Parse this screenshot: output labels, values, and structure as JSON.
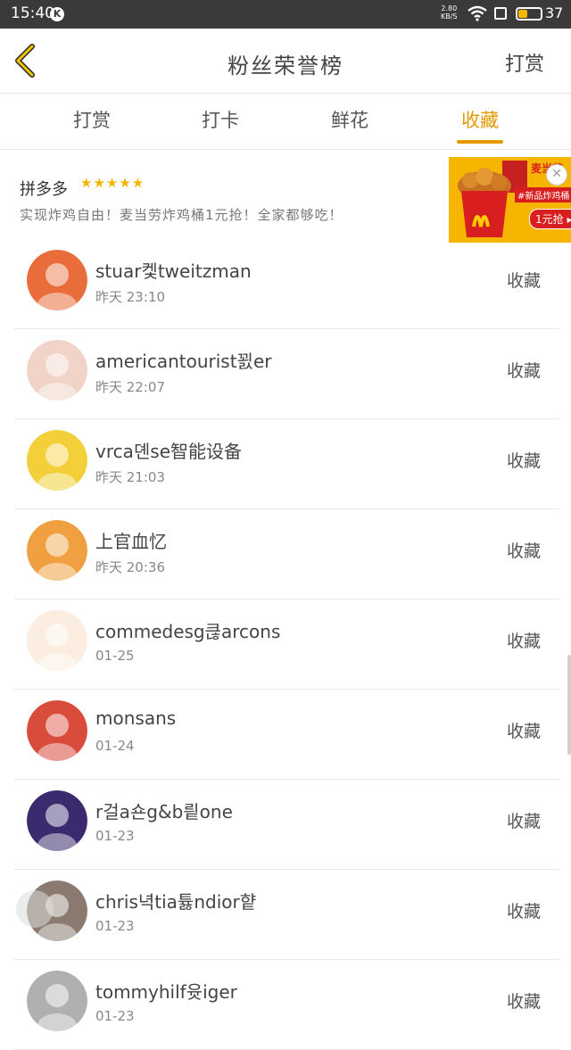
{
  "status_bar": {
    "time": "15:40",
    "app_badge": "K",
    "net_speed_value": "2.80",
    "net_speed_unit": "KB/S",
    "battery": "37",
    "battery_level": 0.37
  },
  "header": {
    "title": "粉丝荣誉榜",
    "right_action": "打赏"
  },
  "tabs": [
    {
      "label": "打赏"
    },
    {
      "label": "打卡"
    },
    {
      "label": "鲜花"
    },
    {
      "label": "收藏",
      "active": true
    }
  ],
  "ad": {
    "title": "拼多多",
    "stars": "★★★★★",
    "description": "实现炸鸡自由！麦当劳炸鸡桶1元抢！全家都够吃！",
    "image_text_top": "麦当劳",
    "image_text_mid": "#新品炸鸡桶",
    "image_text_btn": "1元抢 ▸",
    "close_icon": "close-icon"
  },
  "list": [
    {
      "name": "stuar켗tweitzman",
      "time": "昨天 23:10",
      "action": "收藏",
      "avatar_color": "#e86d3a"
    },
    {
      "name": "americantourist꾌er",
      "time": "昨天 22:07",
      "action": "收藏",
      "avatar_color": "#f1d3c8"
    },
    {
      "name": "vrca뎬se智能设备",
      "time": "昨天 21:03",
      "action": "收藏",
      "avatar_color": "#f3d03a"
    },
    {
      "name": "上官血忆",
      "time": "昨天 20:36",
      "action": "收藏",
      "avatar_color": "#f0a040"
    },
    {
      "name": "commedesg큲arcons",
      "time": "01-25",
      "action": "收藏",
      "avatar_color": "#fbeee0"
    },
    {
      "name": "monsans",
      "time": "01-24",
      "action": "收藏",
      "avatar_color": "#d94c3c"
    },
    {
      "name": "r걸a숀g&b릩one",
      "time": "01-23",
      "action": "收藏",
      "avatar_color": "#3b2b6e"
    },
    {
      "name": "chris녁tia튫ndior햩",
      "time": "01-23",
      "action": "收藏",
      "avatar_color": "#8a7a70"
    },
    {
      "name": "tommyhilf윳iger",
      "time": "01-23",
      "action": "收藏",
      "avatar_color": "#b0b0b0"
    }
  ]
}
